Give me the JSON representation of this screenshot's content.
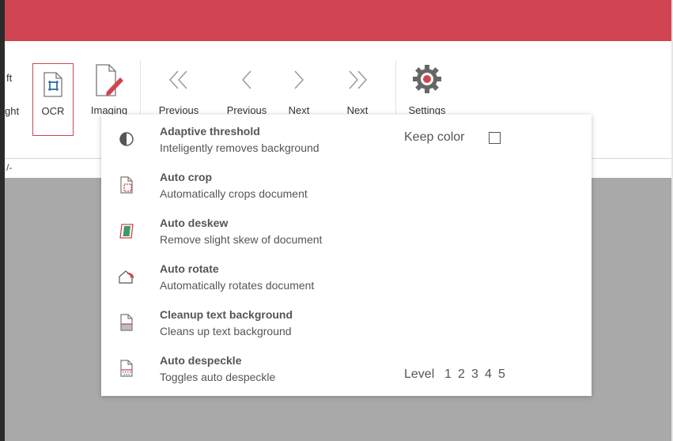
{
  "ribbon": {
    "partial_left_top": "ft",
    "partial_left_bottom": "ght",
    "tools": [
      {
        "label": "OCR"
      },
      {
        "label": "Imaging"
      },
      {
        "label": "Previous"
      },
      {
        "label": "Previous"
      },
      {
        "label": "Next"
      },
      {
        "label": "Next"
      },
      {
        "label": "Settings"
      }
    ]
  },
  "status": {
    "fragment": "/-"
  },
  "menu": {
    "items": [
      {
        "title": "Adaptive threshold",
        "desc": "Inteligently removes background",
        "icon": "contrast-icon"
      },
      {
        "title": "Auto crop",
        "desc": "Automatically crops document",
        "icon": "crop-icon"
      },
      {
        "title": "Auto deskew",
        "desc": "Remove slight skew of document",
        "icon": "deskew-icon"
      },
      {
        "title": "Auto rotate",
        "desc": "Automatically rotates document",
        "icon": "rotate-icon"
      },
      {
        "title": "Cleanup text background",
        "desc": "Cleans up text background",
        "icon": "cleanup-icon"
      },
      {
        "title": "Auto despeckle",
        "desc": "Toggles auto despeckle",
        "icon": "despeckle-icon"
      }
    ],
    "keep_color_label": "Keep color",
    "keep_color_checked": false,
    "level_label": "Level",
    "levels": [
      "1",
      "2",
      "3",
      "4",
      "5"
    ]
  },
  "colors": {
    "accent": "#d04452",
    "canvas": "#a9a9a9"
  }
}
